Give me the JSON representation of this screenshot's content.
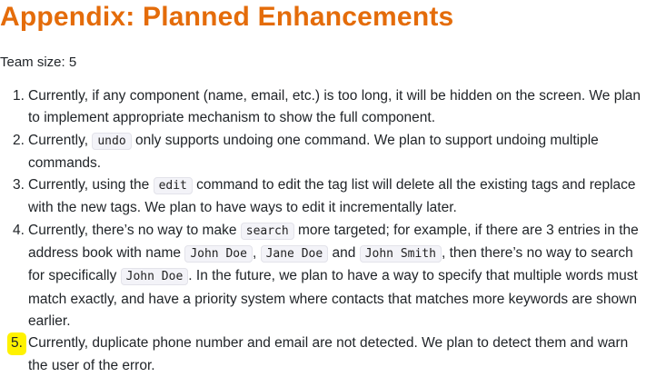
{
  "heading": "Appendix: Planned Enhancements",
  "team_size": "Team size: 5",
  "items": [
    {
      "number": "1.",
      "lines": [
        [
          "Currently, if any component (name, email, etc.) is too long, it will be hidden on the screen. We plan"
        ],
        [
          "to implement appropriate mechanism to show the full component."
        ]
      ]
    },
    {
      "number": "2.",
      "lines": [
        [
          "Currently, ",
          {
            "code": "undo"
          },
          " only supports undoing one command. We plan to support undoing multiple"
        ],
        [
          "commands."
        ]
      ]
    },
    {
      "number": "3.",
      "lines": [
        [
          "Currently, using the ",
          {
            "code": "edit"
          },
          " command to edit the tag list will delete all the existing tags and replace"
        ],
        [
          "with the new tags. We plan to have ways to edit it incrementally later."
        ]
      ]
    },
    {
      "number": "4.",
      "lines": [
        [
          "Currently, there’s no way to make ",
          {
            "code": "search"
          },
          " more targeted; for example, if there are 3 entries in the"
        ],
        [
          "address book with name ",
          {
            "code": "John Doe"
          },
          ", ",
          {
            "code": "Jane Doe"
          },
          " and ",
          {
            "code": "John Smith"
          },
          ", then there’s no way to search"
        ],
        [
          "for specifically ",
          {
            "code": "John Doe"
          },
          ". In the future, we plan to have a way to specify that multiple words must"
        ],
        [
          "match exactly, and have a priority system where contacts that matches more keywords are shown"
        ],
        [
          "earlier."
        ]
      ]
    },
    {
      "number": "5.",
      "highlighted": true,
      "lines": [
        [
          "Currently, duplicate phone number and email are not detected. We plan to detect them and warn"
        ],
        [
          "the user of the error."
        ]
      ]
    }
  ],
  "colors": {
    "heading": "#e46c0a",
    "highlight": "#fff200",
    "code_bg": "#f3f3f8"
  }
}
